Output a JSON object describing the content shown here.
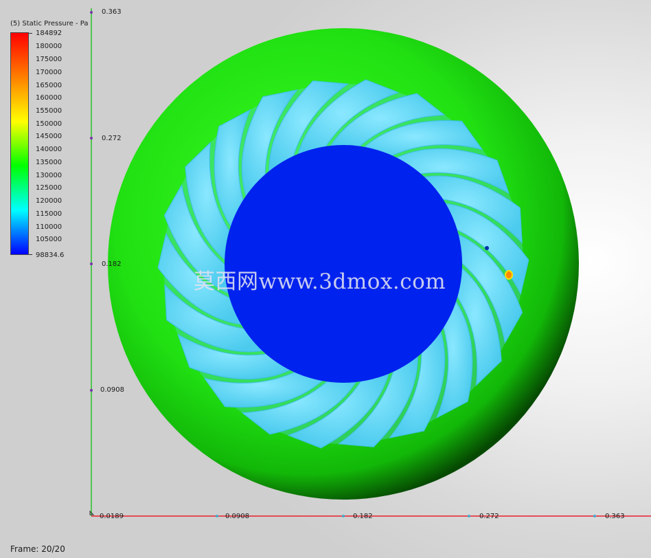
{
  "legend": {
    "title": "(5) Static Pressure - Pa",
    "max_label": "184892",
    "min_label": "98834.6",
    "ticks": [
      "180000",
      "175000",
      "170000",
      "165000",
      "160000",
      "155000",
      "150000",
      "145000",
      "140000",
      "135000",
      "130000",
      "125000",
      "120000",
      "115000",
      "110000",
      "105000"
    ],
    "colors": [
      "#ff0000",
      "#ff8000",
      "#ffff00",
      "#00ff00",
      "#00ffff",
      "#0000ff"
    ]
  },
  "axes": {
    "y_ticks": [
      "0.363",
      "0.272",
      "0.182",
      "0.0908"
    ],
    "x_ticks": [
      "0.0908",
      "0.182",
      "0.272",
      "0.363"
    ],
    "origin_label": "0.0189",
    "x_color": "#e8202a",
    "y_color": "#27c227"
  },
  "plot": {
    "outer_color": "#22dd10",
    "blade_color": "#5ad7f2",
    "hub_color": "#0022ee"
  },
  "frame": "Frame: 20/20",
  "watermark": "莫西网www.3dmox.com"
}
